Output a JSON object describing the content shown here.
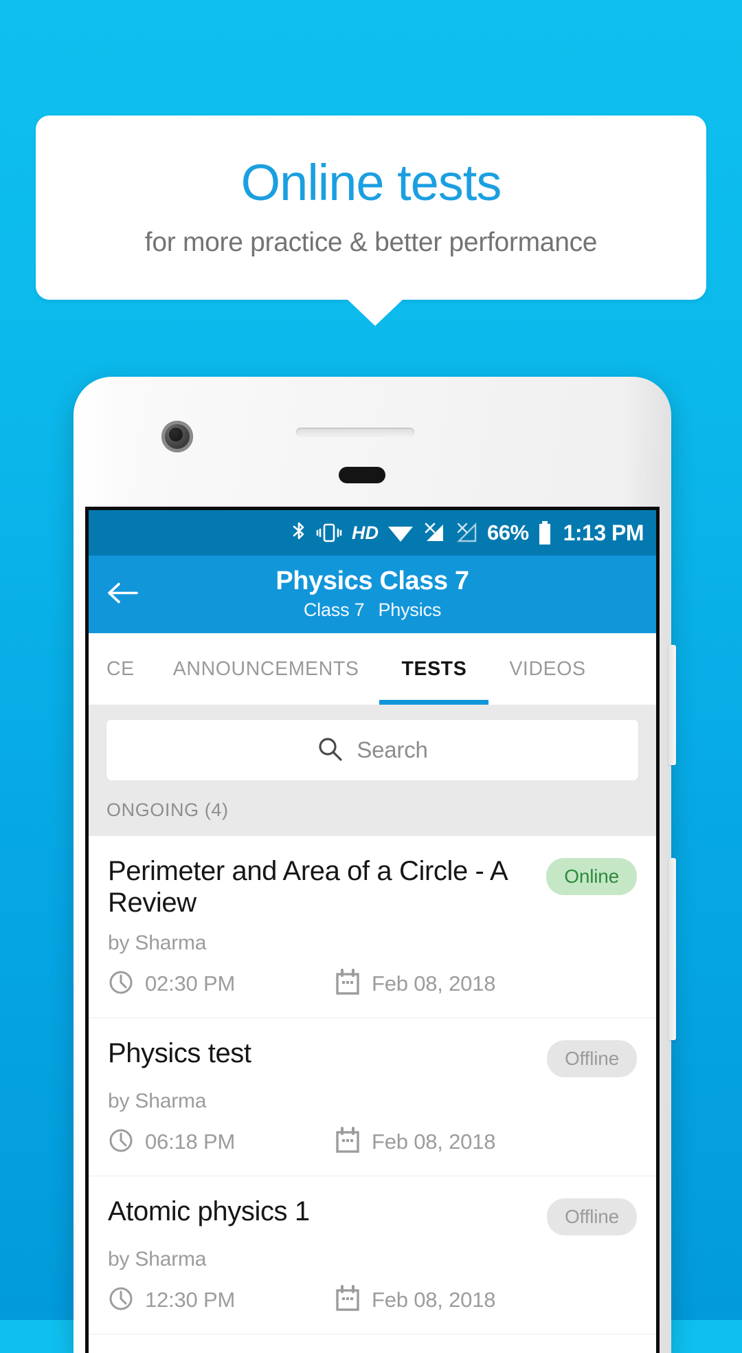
{
  "promo": {
    "title": "Online tests",
    "subtitle": "for more practice & better performance",
    "title_color": "#1b9fe0",
    "subtitle_color": "#737373",
    "background_top": "#0ec0ef",
    "background_bottom": "#029ada"
  },
  "statusbar": {
    "icons": [
      "bluetooth-icon",
      "vibrate-icon",
      "hd-icon",
      "wifi-icon",
      "signal-none-icon",
      "signal-none-2-icon"
    ],
    "hd_label": "HD",
    "battery_percent": "66%",
    "clock": "1:13 PM",
    "background": "#0479b0"
  },
  "appbar": {
    "back_icon": "back-arrow-icon",
    "title": "Physics Class 7",
    "subtitle_class": "Class 7",
    "subtitle_subject": "Physics",
    "background": "#1296da"
  },
  "tabs": [
    {
      "label": "CE",
      "active": false
    },
    {
      "label": "ANNOUNCEMENTS",
      "active": false
    },
    {
      "label": "TESTS",
      "active": true
    },
    {
      "label": "VIDEOS",
      "active": false
    }
  ],
  "search": {
    "icon": "search-icon",
    "placeholder": "Search",
    "value": ""
  },
  "section": {
    "label": "ONGOING (4)"
  },
  "tests": [
    {
      "title": "Perimeter and Area of a Circle - A Review",
      "status": "Online",
      "status_kind": "online",
      "author": "by Sharma",
      "time": "02:30 PM",
      "date": "Feb 08, 2018"
    },
    {
      "title": "Physics test",
      "status": "Offline",
      "status_kind": "offline",
      "author": "by Sharma",
      "time": "06:18 PM",
      "date": "Feb 08, 2018"
    },
    {
      "title": "Atomic physics 1",
      "status": "Offline",
      "status_kind": "offline",
      "author": "by Sharma",
      "time": "12:30 PM",
      "date": "Feb 08, 2018"
    }
  ],
  "colors": {
    "accent": "#1296da",
    "status_online_bg": "#c5e7c6",
    "status_online_fg": "#2d8a3c",
    "status_offline_bg": "#e5e5e5",
    "status_offline_fg": "#9b9b9b"
  }
}
